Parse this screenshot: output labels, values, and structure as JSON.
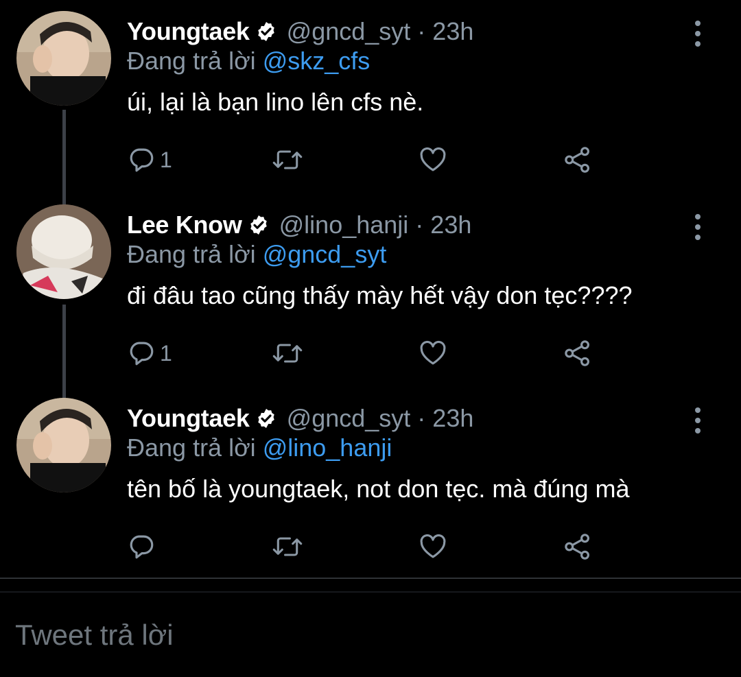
{
  "tweets": [
    {
      "name": "Youngtaek",
      "handle": "@gncd_syt",
      "separator": "·",
      "time": "23h",
      "reply_prefix": "Đang trả lời",
      "reply_to": "@skz_cfs",
      "text": "úi, lại là bạn lino lên cfs nè.",
      "reply_count": "1"
    },
    {
      "name": "Lee Know",
      "handle": "@lino_hanji",
      "separator": "·",
      "time": "23h",
      "reply_prefix": "Đang trả lời",
      "reply_to": "@gncd_syt",
      "text": "đi đâu tao cũng thấy mày hết vậy don tẹc????",
      "reply_count": "1"
    },
    {
      "name": "Youngtaek",
      "handle": "@gncd_syt",
      "separator": "·",
      "time": "23h",
      "reply_prefix": "Đang trả lời",
      "reply_to": "@lino_hanji",
      "text": "tên bố là youngtaek, not don tẹc. mà đúng mà",
      "reply_count": ""
    }
  ],
  "compose": {
    "placeholder": "Tweet trả lời"
  },
  "icons": {
    "reply": "reply-icon",
    "retweet": "retweet-icon",
    "like": "heart-icon",
    "share": "share-icon",
    "verified": "verified-badge-icon",
    "more": "more-options-icon"
  },
  "colors": {
    "background": "#000000",
    "text": "#ffffff",
    "secondary": "#8b98a5",
    "link": "#3d9cf0",
    "thread_line": "#3d4148"
  }
}
